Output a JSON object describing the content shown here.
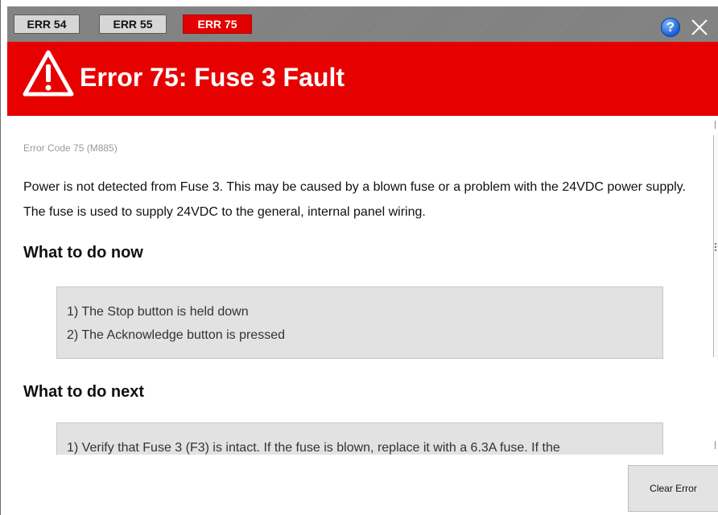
{
  "tabs": [
    {
      "label": "ERR 54",
      "active": false
    },
    {
      "label": "ERR 55",
      "active": false
    },
    {
      "label": "ERR 75",
      "active": true
    }
  ],
  "toolbar": {
    "help_label": "?",
    "help_icon": "help-icon",
    "close_icon": "close-icon"
  },
  "header": {
    "title": "Error 75: Fuse 3 Fault",
    "icon": "warning-triangle-icon",
    "color": "#e60000"
  },
  "content": {
    "error_code": "Error Code 75 (M885)",
    "description": "Power is not detected from Fuse 3. This may be caused by a blown fuse or a problem with the 24VDC power supply. The fuse is used to supply 24VDC to the general, internal panel wiring.",
    "now_heading": "What to do now",
    "now_steps": [
      "1) The Stop button is held down",
      "2) The Acknowledge button is pressed"
    ],
    "next_heading": "What to do next",
    "next_steps": [
      "1) Verify that Fuse 3 (F3) is intact. If the fuse is blown, replace it with a 6.3A fuse. If the"
    ]
  },
  "footer": {
    "clear_label": "Clear Error"
  }
}
